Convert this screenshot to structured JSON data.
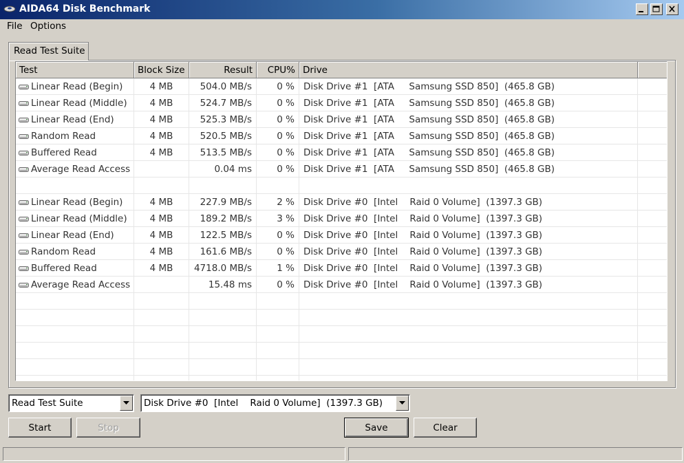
{
  "window": {
    "title": "AIDA64 Disk Benchmark"
  },
  "menu": {
    "file": "File",
    "options": "Options"
  },
  "tab": {
    "label": "Read Test Suite"
  },
  "columns": {
    "test": "Test",
    "block_size": "Block Size",
    "result": "Result",
    "cpu": "CPU%",
    "drive": "Drive"
  },
  "rows": [
    {
      "test": "Linear Read (Begin)",
      "block": "4 MB",
      "result": "504.0 MB/s",
      "cpu": "0 %",
      "drive": "Disk Drive #1  [ATA     Samsung SSD 850]  (465.8 GB)"
    },
    {
      "test": "Linear Read (Middle)",
      "block": "4 MB",
      "result": "524.7 MB/s",
      "cpu": "0 %",
      "drive": "Disk Drive #1  [ATA     Samsung SSD 850]  (465.8 GB)"
    },
    {
      "test": "Linear Read (End)",
      "block": "4 MB",
      "result": "525.3 MB/s",
      "cpu": "0 %",
      "drive": "Disk Drive #1  [ATA     Samsung SSD 850]  (465.8 GB)"
    },
    {
      "test": "Random Read",
      "block": "4 MB",
      "result": "520.5 MB/s",
      "cpu": "0 %",
      "drive": "Disk Drive #1  [ATA     Samsung SSD 850]  (465.8 GB)"
    },
    {
      "test": "Buffered Read",
      "block": "4 MB",
      "result": "513.5 MB/s",
      "cpu": "0 %",
      "drive": "Disk Drive #1  [ATA     Samsung SSD 850]  (465.8 GB)"
    },
    {
      "test": "Average Read Access",
      "block": "",
      "result": "0.04 ms",
      "cpu": "0 %",
      "drive": "Disk Drive #1  [ATA     Samsung SSD 850]  (465.8 GB)"
    },
    {
      "test": "",
      "block": "",
      "result": "",
      "cpu": "",
      "drive": ""
    },
    {
      "test": "Linear Read (Begin)",
      "block": "4 MB",
      "result": "227.9 MB/s",
      "cpu": "2 %",
      "drive": "Disk Drive #0  [Intel    Raid 0 Volume]  (1397.3 GB)"
    },
    {
      "test": "Linear Read (Middle)",
      "block": "4 MB",
      "result": "189.2 MB/s",
      "cpu": "3 %",
      "drive": "Disk Drive #0  [Intel    Raid 0 Volume]  (1397.3 GB)"
    },
    {
      "test": "Linear Read (End)",
      "block": "4 MB",
      "result": "122.5 MB/s",
      "cpu": "0 %",
      "drive": "Disk Drive #0  [Intel    Raid 0 Volume]  (1397.3 GB)"
    },
    {
      "test": "Random Read",
      "block": "4 MB",
      "result": "161.6 MB/s",
      "cpu": "0 %",
      "drive": "Disk Drive #0  [Intel    Raid 0 Volume]  (1397.3 GB)"
    },
    {
      "test": "Buffered Read",
      "block": "4 MB",
      "result": "4718.0 MB/s",
      "cpu": "1 %",
      "drive": "Disk Drive #0  [Intel    Raid 0 Volume]  (1397.3 GB)"
    },
    {
      "test": "Average Read Access",
      "block": "",
      "result": "15.48 ms",
      "cpu": "0 %",
      "drive": "Disk Drive #0  [Intel    Raid 0 Volume]  (1397.3 GB)"
    },
    {
      "test": "",
      "block": "",
      "result": "",
      "cpu": "",
      "drive": ""
    },
    {
      "test": "",
      "block": "",
      "result": "",
      "cpu": "",
      "drive": ""
    },
    {
      "test": "",
      "block": "",
      "result": "",
      "cpu": "",
      "drive": ""
    },
    {
      "test": "",
      "block": "",
      "result": "",
      "cpu": "",
      "drive": ""
    },
    {
      "test": "",
      "block": "",
      "result": "",
      "cpu": "",
      "drive": ""
    },
    {
      "test": "",
      "block": "",
      "result": "",
      "cpu": "",
      "drive": ""
    }
  ],
  "controls": {
    "suite_select": "Read Test Suite",
    "drive_select": "Disk Drive #0  [Intel    Raid 0 Volume]  (1397.3 GB)",
    "start": "Start",
    "stop": "Stop",
    "save": "Save",
    "clear": "Clear"
  },
  "status": {
    "left": "",
    "right": ""
  },
  "icons": {
    "app": "disk-benchmark-icon",
    "row": "hard-drive-icon",
    "dropdown": "chevron-down-icon"
  }
}
